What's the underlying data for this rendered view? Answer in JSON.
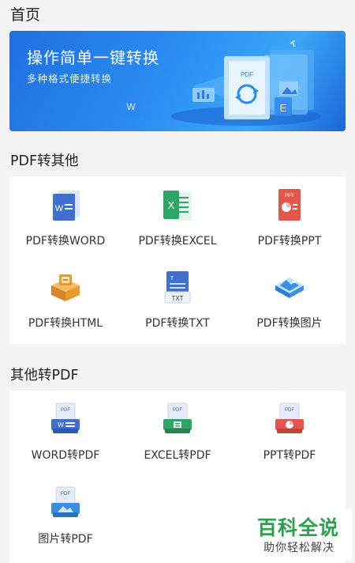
{
  "page": {
    "title": "首页"
  },
  "banner": {
    "title": "操作简单一键转换",
    "subtitle": "多种格式便捷转换",
    "art_text": {
      "pdf": "PDF",
      "w": "W",
      "e": "E"
    }
  },
  "sections": {
    "pdf_to_other": {
      "title": "PDF转其他",
      "items": [
        {
          "label": "PDF转换WORD",
          "icon": "word-doc-icon"
        },
        {
          "label": "PDF转换EXCEL",
          "icon": "excel-doc-icon"
        },
        {
          "label": "PDF转换PPT",
          "icon": "ppt-doc-icon"
        },
        {
          "label": "PDF转换HTML",
          "icon": "html-box-icon"
        },
        {
          "label": "PDF转换TXT",
          "icon": "txt-doc-icon"
        },
        {
          "label": "PDF转换图片",
          "icon": "image-icon"
        }
      ]
    },
    "other_to_pdf": {
      "title": "其他转PDF",
      "items": [
        {
          "label": "WORD转PDF",
          "icon": "word-to-pdf-icon"
        },
        {
          "label": "EXCEL转PDF",
          "icon": "excel-to-pdf-icon"
        },
        {
          "label": "PPT转PDF",
          "icon": "ppt-to-pdf-icon"
        },
        {
          "label": "图片转PDF",
          "icon": "image-to-pdf-icon"
        }
      ]
    }
  },
  "icon_text": {
    "w": "W",
    "x": "X",
    "ppt": "PPT",
    "txt": "TXT",
    "pdf": "PDF"
  },
  "watermark": {
    "main": "百科全说",
    "sub": "助你轻松解决"
  },
  "colors": {
    "word": "#3f6fd1",
    "excel": "#2ea667",
    "ppt": "#e4554c",
    "html": "#e99a2c",
    "txt": "#3f6fd1",
    "image": "#3b8fe0",
    "watermark": "#2aa14a"
  }
}
